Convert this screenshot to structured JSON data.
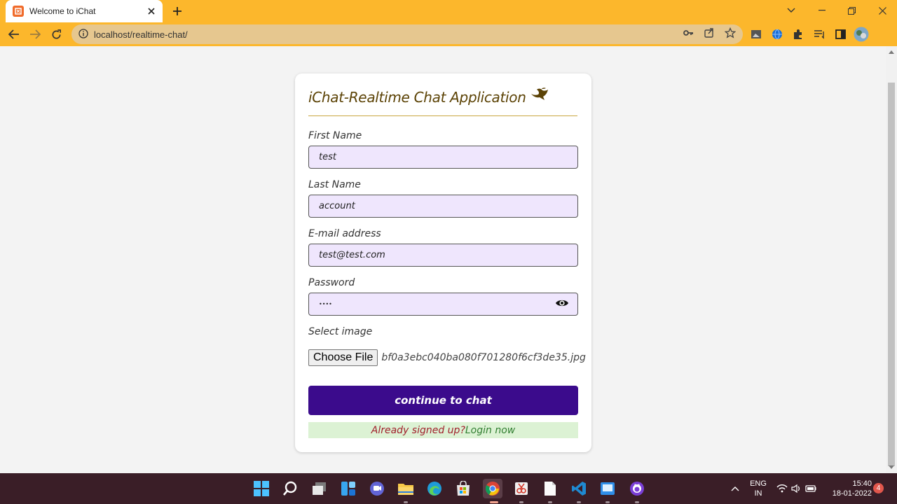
{
  "browser": {
    "tab_title": "Welcome to iChat",
    "url": "localhost/realtime-chat/"
  },
  "form": {
    "title": "iChat-Realtime Chat Application",
    "first_name": {
      "label": "First Name",
      "value": "test"
    },
    "last_name": {
      "label": "Last Name",
      "value": "account"
    },
    "email": {
      "label": "E-mail address",
      "value": "test@test.com"
    },
    "password": {
      "label": "Password",
      "value": "••••"
    },
    "image": {
      "label": "Select image",
      "button": "Choose File",
      "file_name": "bf0a3ebc040ba080f701280f6cf3de35.jpg"
    },
    "submit_label": "continue to chat",
    "login_prompt": "Already signed up?",
    "login_link": "Login now"
  },
  "taskbar": {
    "lang_top": "ENG",
    "lang_bottom": "IN",
    "time": "15:40",
    "date": "18-01-2022",
    "notification_count": "4"
  },
  "colors": {
    "browser_frame": "#fcb72c",
    "submit_button": "#3b0b8c",
    "input_background": "#efe6fd",
    "login_background": "#dcf2d4",
    "taskbar": "#3a1e27"
  }
}
